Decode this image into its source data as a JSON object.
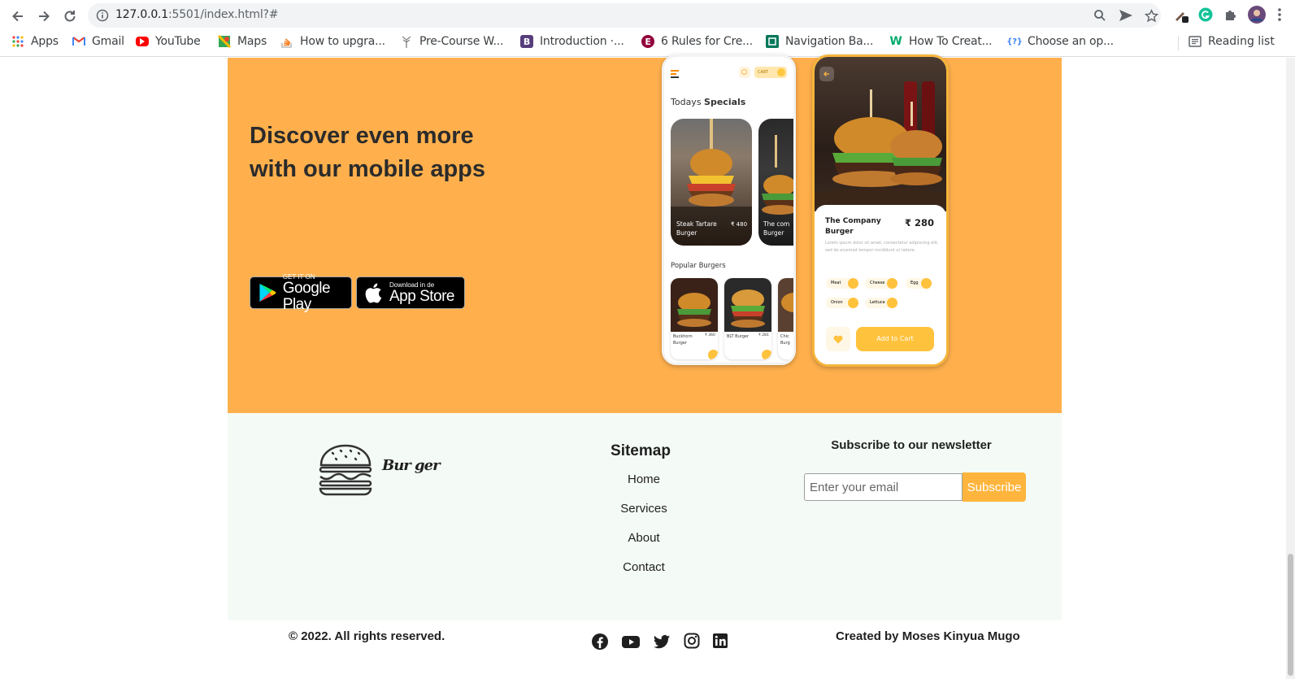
{
  "browser": {
    "url_host": "127.0.0.1",
    "url_rest": ":5501/index.html?#",
    "bookmarks": [
      {
        "label": "Apps",
        "icon": "apps-grid-icon"
      },
      {
        "label": "Gmail",
        "icon": "gmail-icon"
      },
      {
        "label": "YouTube",
        "icon": "youtube-icon"
      },
      {
        "label": "Maps",
        "icon": "maps-icon"
      },
      {
        "label": "How to upgra...",
        "icon": "stack-overflow-icon"
      },
      {
        "label": "Pre-Course W...",
        "icon": "tree-icon"
      },
      {
        "label": "Introduction ·...",
        "icon": "bootstrap-icon"
      },
      {
        "label": "6 Rules for Cre...",
        "icon": "elementor-icon"
      },
      {
        "label": "Navigation Ba...",
        "icon": "bookmark-page-icon"
      },
      {
        "label": "How To Creat...",
        "icon": "w3-icon"
      },
      {
        "label": "Choose an op...",
        "icon": "question-icon"
      }
    ],
    "reading_list": "Reading list"
  },
  "app_section": {
    "heading": "Discover even more with our mobile apps",
    "google_play": {
      "small": "GET IT ON",
      "big": "Google Play"
    },
    "app_store": {
      "small": "Download in de",
      "big": "App Store"
    },
    "phone1": {
      "title_light": "Todays",
      "title_bold": "Specials",
      "cart": "CART",
      "special1_name": "Steak Tartare Burger",
      "special1_price": "₹ 480",
      "special2_name": "The com Burger",
      "popular_title": "Popular Burgers",
      "popular1": "Buckhorn Burger",
      "popular1_price": "₹ 360",
      "popular2": "BLT Burger",
      "popular2_price": "₹ 281",
      "popular3": "Chic Burg"
    },
    "phone2": {
      "name": "The Company Burger",
      "price": "₹ 280",
      "desc": "Lorem ipsum dolor sit amet, consectetur adipiscing elit, sed do eiusmod tempor incididunt ut labore.",
      "toppings": [
        "Meat",
        "Cheese",
        "Egg",
        "Onion",
        "Lettuce"
      ],
      "add_to_cart": "Add to Cart"
    }
  },
  "footer": {
    "brand": "Bur ger",
    "sitemap_title": "Sitemap",
    "sitemap_links": [
      "Home",
      "Services",
      "About",
      "Contact"
    ],
    "newsletter_title": "Subscribe to our newsletter",
    "email_placeholder": "Enter your email",
    "subscribe_label": "Subscribe"
  },
  "bottom_bar": {
    "copyright": "© 2022. All rights reserved.",
    "creator": "Created by Moses Kinyua Mugo",
    "social_icons": [
      "facebook-icon",
      "youtube-icon",
      "twitter-icon",
      "instagram-icon",
      "linkedin-icon"
    ]
  },
  "colors": {
    "app_section_bg": "#ffb04d",
    "footer_bg": "#f4fbf6",
    "accent": "#ffb53d"
  }
}
